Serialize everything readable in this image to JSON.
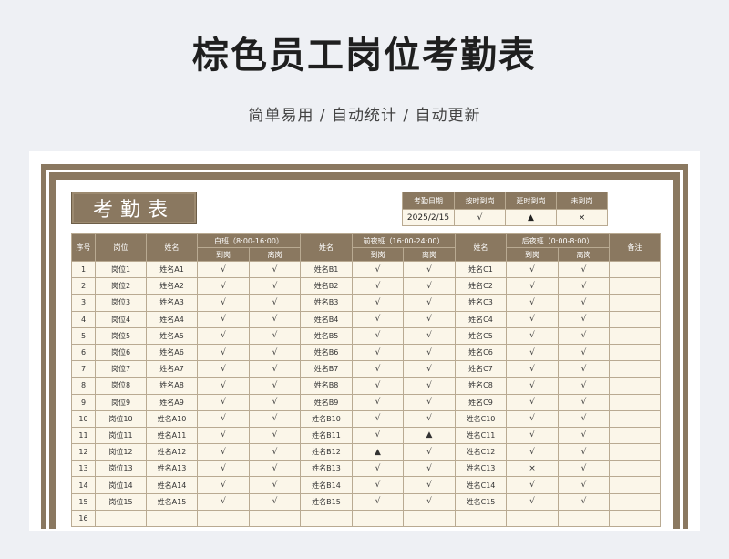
{
  "page": {
    "title": "棕色员工岗位考勤表",
    "subtitle": "简单易用  /  自动统计  /  自动更新"
  },
  "sheet": {
    "banner": "考勤表",
    "legend": {
      "headers": [
        "考勤日期",
        "按时到岗",
        "延时到岗",
        "未到岗"
      ],
      "values": [
        "2025/2/15",
        "√",
        "▲",
        "×"
      ]
    },
    "headers": {
      "no": "序号",
      "post": "岗位",
      "name": "姓名",
      "remark": "备注",
      "arrive": "到岗",
      "leave": "离岗",
      "shifts": [
        "白班（8:00-16:00）",
        "前夜班（16:00-24:00）",
        "后夜班（0:00-8:00）"
      ]
    },
    "rows": [
      [
        "1",
        "岗位1",
        "姓名A1",
        "√",
        "√",
        "姓名B1",
        "√",
        "√",
        "姓名C1",
        "√",
        "√",
        ""
      ],
      [
        "2",
        "岗位2",
        "姓名A2",
        "√",
        "√",
        "姓名B2",
        "√",
        "√",
        "姓名C2",
        "√",
        "√",
        ""
      ],
      [
        "3",
        "岗位3",
        "姓名A3",
        "√",
        "√",
        "姓名B3",
        "√",
        "√",
        "姓名C3",
        "√",
        "√",
        ""
      ],
      [
        "4",
        "岗位4",
        "姓名A4",
        "√",
        "√",
        "姓名B4",
        "√",
        "√",
        "姓名C4",
        "√",
        "√",
        ""
      ],
      [
        "5",
        "岗位5",
        "姓名A5",
        "√",
        "√",
        "姓名B5",
        "√",
        "√",
        "姓名C5",
        "√",
        "√",
        ""
      ],
      [
        "6",
        "岗位6",
        "姓名A6",
        "√",
        "√",
        "姓名B6",
        "√",
        "√",
        "姓名C6",
        "√",
        "√",
        ""
      ],
      [
        "7",
        "岗位7",
        "姓名A7",
        "√",
        "√",
        "姓名B7",
        "√",
        "√",
        "姓名C7",
        "√",
        "√",
        ""
      ],
      [
        "8",
        "岗位8",
        "姓名A8",
        "√",
        "√",
        "姓名B8",
        "√",
        "√",
        "姓名C8",
        "√",
        "√",
        ""
      ],
      [
        "9",
        "岗位9",
        "姓名A9",
        "√",
        "√",
        "姓名B9",
        "√",
        "√",
        "姓名C9",
        "√",
        "√",
        ""
      ],
      [
        "10",
        "岗位10",
        "姓名A10",
        "√",
        "√",
        "姓名B10",
        "√",
        "√",
        "姓名C10",
        "√",
        "√",
        ""
      ],
      [
        "11",
        "岗位11",
        "姓名A11",
        "√",
        "√",
        "姓名B11",
        "√",
        "▲",
        "姓名C11",
        "√",
        "√",
        ""
      ],
      [
        "12",
        "岗位12",
        "姓名A12",
        "√",
        "√",
        "姓名B12",
        "▲",
        "√",
        "姓名C12",
        "√",
        "√",
        ""
      ],
      [
        "13",
        "岗位13",
        "姓名A13",
        "√",
        "√",
        "姓名B13",
        "√",
        "√",
        "姓名C13",
        "×",
        "√",
        ""
      ],
      [
        "14",
        "岗位14",
        "姓名A14",
        "√",
        "√",
        "姓名B14",
        "√",
        "√",
        "姓名C14",
        "√",
        "√",
        ""
      ],
      [
        "15",
        "岗位15",
        "姓名A15",
        "√",
        "√",
        "姓名B15",
        "√",
        "√",
        "姓名C15",
        "√",
        "√",
        ""
      ],
      [
        "16",
        "",
        "",
        "",
        "",
        "",
        "",
        "",
        "",
        "",
        "",
        ""
      ]
    ]
  }
}
